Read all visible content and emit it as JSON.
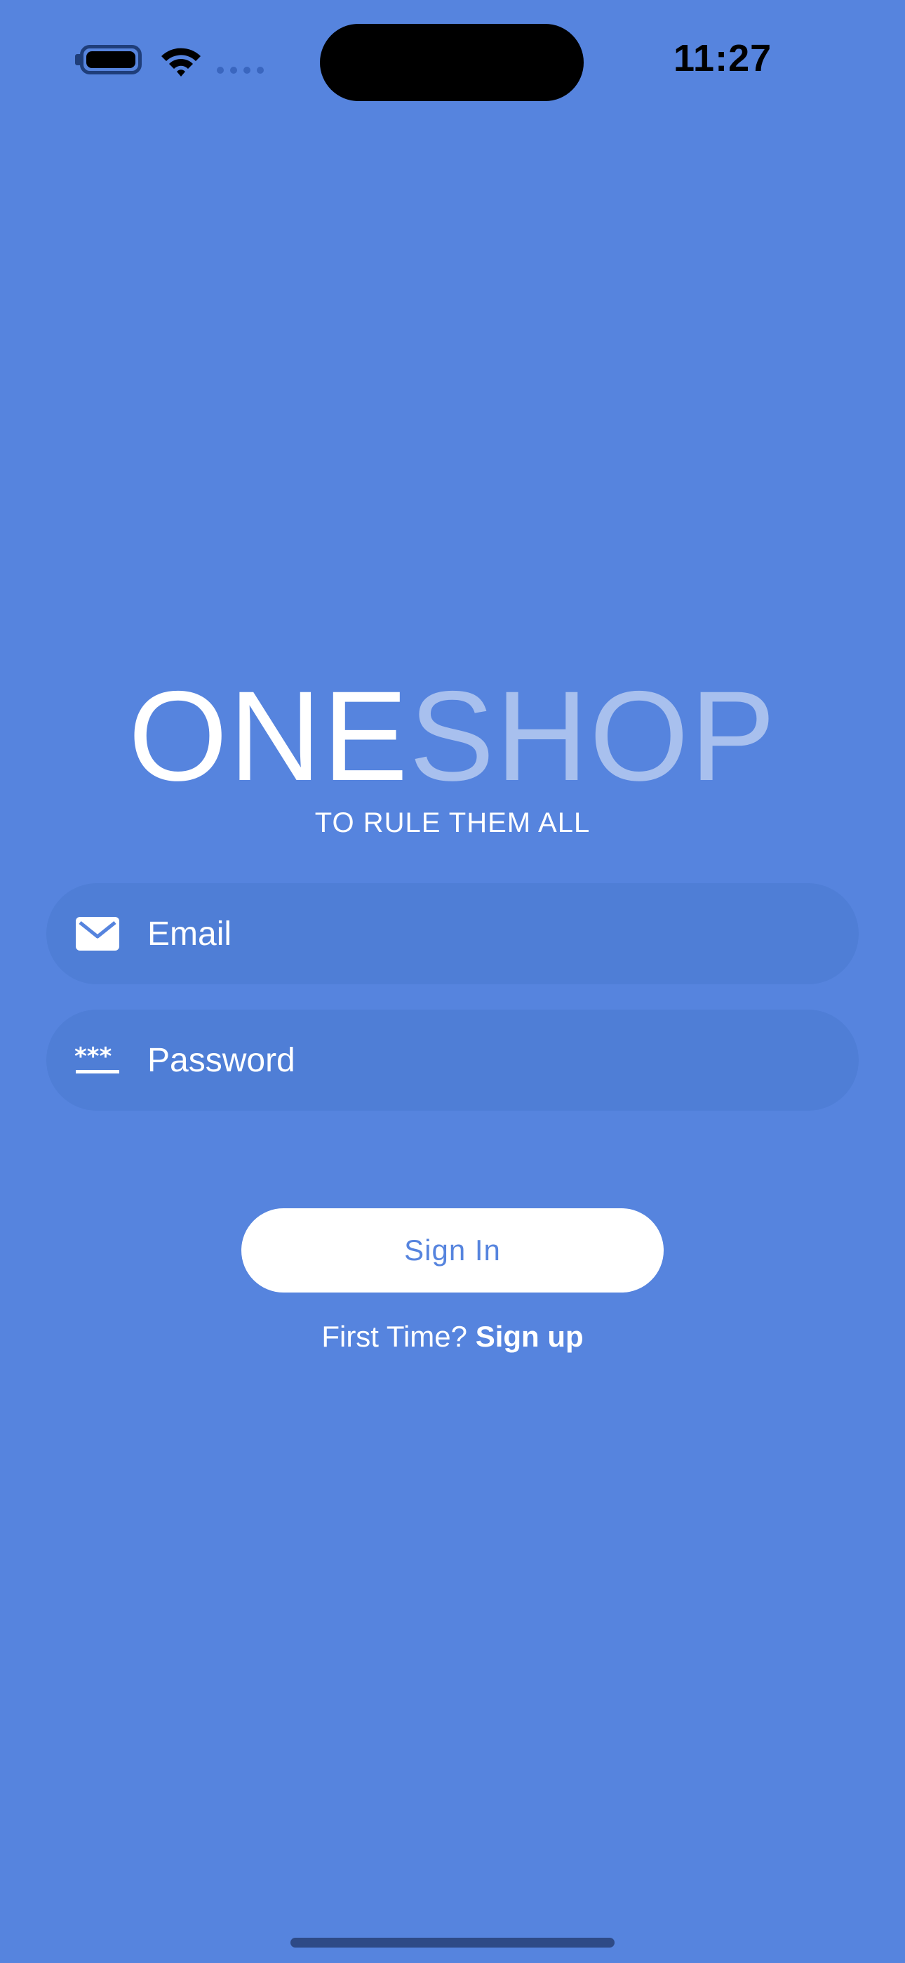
{
  "status_bar": {
    "time": "11:27",
    "battery_icon": "battery-icon",
    "wifi_icon": "wifi-icon",
    "signal_icon": "cellular-signal-icon"
  },
  "brand": {
    "part_one": "ONE",
    "part_two": "SHOP",
    "tagline": "TO RULE THEM ALL"
  },
  "form": {
    "email": {
      "placeholder": "Email",
      "value": "",
      "icon": "envelope-icon"
    },
    "password": {
      "placeholder": "Password",
      "value": "",
      "icon": "password-icon"
    },
    "sign_in_label": "Sign In",
    "signup_prompt": "First Time?",
    "signup_link": "Sign up"
  },
  "colors": {
    "background": "#5684de",
    "field_background": "#4f7ed6",
    "brand_secondary": "#a8c0ee",
    "button_background": "#ffffff",
    "button_text": "#5684de"
  }
}
